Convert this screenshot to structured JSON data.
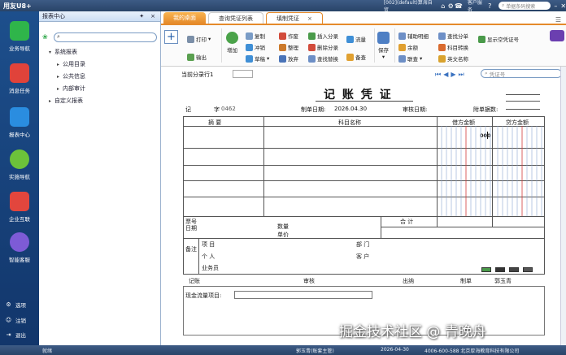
{
  "titlebar": {
    "logo": "用友U8+",
    "account": "[002](default)算海自贸",
    "menu1": "客户服务",
    "search_placeholder": "单据条码搜索"
  },
  "leftnav": {
    "items": [
      "业务导航",
      "消息任务",
      "报表中心",
      "实施导航",
      "企业互联",
      "智能客服"
    ],
    "bottom": [
      "选项",
      "注销",
      "退出"
    ]
  },
  "panel": {
    "title": "报表中心",
    "tree": [
      {
        "label": "系统报表",
        "toggle": "▾"
      },
      {
        "label": "公用目录",
        "toggle": "▸"
      },
      {
        "label": "公共信息",
        "toggle": "▸"
      },
      {
        "label": "内部审计",
        "toggle": "▸"
      },
      {
        "label": "自定义报表",
        "toggle": "▸"
      }
    ]
  },
  "tabs": [
    {
      "label": "我的桌面"
    },
    {
      "label": "查询凭证列表"
    },
    {
      "label": "填制凭证",
      "close": "×"
    }
  ],
  "toolbar": {
    "print": "打印",
    "export": "输出",
    "add": "增加",
    "copy": "复制",
    "offset": "冲销",
    "draft": "草稿",
    "void": "作废",
    "arrange": "整理",
    "discard": "放弃",
    "insert_entry": "插入分录",
    "delete_entry": "删除分录",
    "find_replace": "查找替换",
    "flow": "流量",
    "backup": "备查",
    "save": "保存",
    "aux_detail": "辅助明细",
    "balance": "余额",
    "link_query": "联查",
    "find_entry": "查找分单",
    "subject_convert": "科目转换",
    "english_name": "英文名称",
    "show_empty": "显示空凭证号"
  },
  "doc": {
    "current_row": "当前分录行1",
    "voucher_search_placeholder": "凭证号",
    "title": "记 账 凭 证",
    "voucher_type": "记",
    "voucher_no_label": "字",
    "voucher_no": "0462",
    "made_date_label": "制单日期:",
    "made_date": "2026.04.30",
    "audit_date_label": "审核日期:",
    "attach_label": "附单据数:",
    "col_summary": "摘 要",
    "col_subject": "科目名称",
    "col_debit": "借方金额",
    "col_credit": "贷方金额",
    "debit_cell": "000",
    "ticket_no": "票号",
    "date": "日期",
    "qty": "数量",
    "unit_price": "单价",
    "total": "合 计",
    "remark": "备注",
    "project": "项 目",
    "dept": "部 门",
    "person": "个 人",
    "customer": "客 户",
    "salesman": "业务员",
    "bookkeeper": "记账",
    "auditor": "审核",
    "cashier": "出纳",
    "maker_label": "制单",
    "maker": "郭玉青",
    "cashflow": "现金流量项目:"
  },
  "status": {
    "ready": "就绪",
    "user": "郭玉青(账套主管)",
    "date": "2026-04-30",
    "phone": "4006-600-588 北京厚海教育科技有限公司"
  },
  "watermark": "掘金技术社区 @ 青晚舟"
}
